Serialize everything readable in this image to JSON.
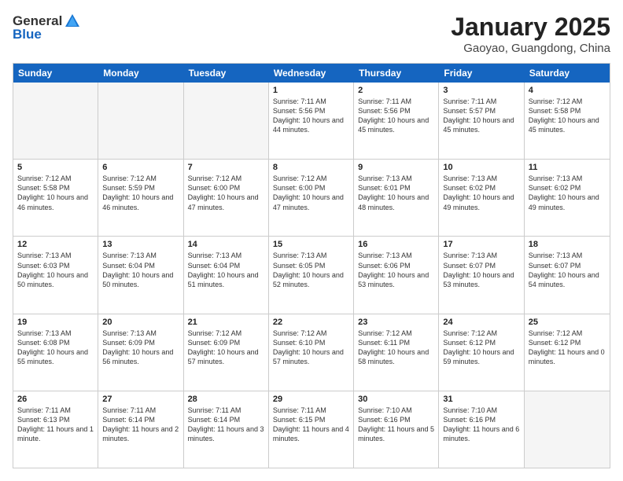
{
  "logo": {
    "general": "General",
    "blue": "Blue"
  },
  "title": "January 2025",
  "location": "Gaoyao, Guangdong, China",
  "day_headers": [
    "Sunday",
    "Monday",
    "Tuesday",
    "Wednesday",
    "Thursday",
    "Friday",
    "Saturday"
  ],
  "weeks": [
    [
      {
        "day": "",
        "empty": true
      },
      {
        "day": "",
        "empty": true
      },
      {
        "day": "",
        "empty": true
      },
      {
        "day": "1",
        "sunrise": "Sunrise: 7:11 AM",
        "sunset": "Sunset: 5:56 PM",
        "daylight": "Daylight: 10 hours and 44 minutes."
      },
      {
        "day": "2",
        "sunrise": "Sunrise: 7:11 AM",
        "sunset": "Sunset: 5:56 PM",
        "daylight": "Daylight: 10 hours and 45 minutes."
      },
      {
        "day": "3",
        "sunrise": "Sunrise: 7:11 AM",
        "sunset": "Sunset: 5:57 PM",
        "daylight": "Daylight: 10 hours and 45 minutes."
      },
      {
        "day": "4",
        "sunrise": "Sunrise: 7:12 AM",
        "sunset": "Sunset: 5:58 PM",
        "daylight": "Daylight: 10 hours and 45 minutes."
      }
    ],
    [
      {
        "day": "5",
        "sunrise": "Sunrise: 7:12 AM",
        "sunset": "Sunset: 5:58 PM",
        "daylight": "Daylight: 10 hours and 46 minutes."
      },
      {
        "day": "6",
        "sunrise": "Sunrise: 7:12 AM",
        "sunset": "Sunset: 5:59 PM",
        "daylight": "Daylight: 10 hours and 46 minutes."
      },
      {
        "day": "7",
        "sunrise": "Sunrise: 7:12 AM",
        "sunset": "Sunset: 6:00 PM",
        "daylight": "Daylight: 10 hours and 47 minutes."
      },
      {
        "day": "8",
        "sunrise": "Sunrise: 7:12 AM",
        "sunset": "Sunset: 6:00 PM",
        "daylight": "Daylight: 10 hours and 47 minutes."
      },
      {
        "day": "9",
        "sunrise": "Sunrise: 7:13 AM",
        "sunset": "Sunset: 6:01 PM",
        "daylight": "Daylight: 10 hours and 48 minutes."
      },
      {
        "day": "10",
        "sunrise": "Sunrise: 7:13 AM",
        "sunset": "Sunset: 6:02 PM",
        "daylight": "Daylight: 10 hours and 49 minutes."
      },
      {
        "day": "11",
        "sunrise": "Sunrise: 7:13 AM",
        "sunset": "Sunset: 6:02 PM",
        "daylight": "Daylight: 10 hours and 49 minutes."
      }
    ],
    [
      {
        "day": "12",
        "sunrise": "Sunrise: 7:13 AM",
        "sunset": "Sunset: 6:03 PM",
        "daylight": "Daylight: 10 hours and 50 minutes."
      },
      {
        "day": "13",
        "sunrise": "Sunrise: 7:13 AM",
        "sunset": "Sunset: 6:04 PM",
        "daylight": "Daylight: 10 hours and 50 minutes."
      },
      {
        "day": "14",
        "sunrise": "Sunrise: 7:13 AM",
        "sunset": "Sunset: 6:04 PM",
        "daylight": "Daylight: 10 hours and 51 minutes."
      },
      {
        "day": "15",
        "sunrise": "Sunrise: 7:13 AM",
        "sunset": "Sunset: 6:05 PM",
        "daylight": "Daylight: 10 hours and 52 minutes."
      },
      {
        "day": "16",
        "sunrise": "Sunrise: 7:13 AM",
        "sunset": "Sunset: 6:06 PM",
        "daylight": "Daylight: 10 hours and 53 minutes."
      },
      {
        "day": "17",
        "sunrise": "Sunrise: 7:13 AM",
        "sunset": "Sunset: 6:07 PM",
        "daylight": "Daylight: 10 hours and 53 minutes."
      },
      {
        "day": "18",
        "sunrise": "Sunrise: 7:13 AM",
        "sunset": "Sunset: 6:07 PM",
        "daylight": "Daylight: 10 hours and 54 minutes."
      }
    ],
    [
      {
        "day": "19",
        "sunrise": "Sunrise: 7:13 AM",
        "sunset": "Sunset: 6:08 PM",
        "daylight": "Daylight: 10 hours and 55 minutes."
      },
      {
        "day": "20",
        "sunrise": "Sunrise: 7:13 AM",
        "sunset": "Sunset: 6:09 PM",
        "daylight": "Daylight: 10 hours and 56 minutes."
      },
      {
        "day": "21",
        "sunrise": "Sunrise: 7:12 AM",
        "sunset": "Sunset: 6:09 PM",
        "daylight": "Daylight: 10 hours and 57 minutes."
      },
      {
        "day": "22",
        "sunrise": "Sunrise: 7:12 AM",
        "sunset": "Sunset: 6:10 PM",
        "daylight": "Daylight: 10 hours and 57 minutes."
      },
      {
        "day": "23",
        "sunrise": "Sunrise: 7:12 AM",
        "sunset": "Sunset: 6:11 PM",
        "daylight": "Daylight: 10 hours and 58 minutes."
      },
      {
        "day": "24",
        "sunrise": "Sunrise: 7:12 AM",
        "sunset": "Sunset: 6:12 PM",
        "daylight": "Daylight: 10 hours and 59 minutes."
      },
      {
        "day": "25",
        "sunrise": "Sunrise: 7:12 AM",
        "sunset": "Sunset: 6:12 PM",
        "daylight": "Daylight: 11 hours and 0 minutes."
      }
    ],
    [
      {
        "day": "26",
        "sunrise": "Sunrise: 7:11 AM",
        "sunset": "Sunset: 6:13 PM",
        "daylight": "Daylight: 11 hours and 1 minute."
      },
      {
        "day": "27",
        "sunrise": "Sunrise: 7:11 AM",
        "sunset": "Sunset: 6:14 PM",
        "daylight": "Daylight: 11 hours and 2 minutes."
      },
      {
        "day": "28",
        "sunrise": "Sunrise: 7:11 AM",
        "sunset": "Sunset: 6:14 PM",
        "daylight": "Daylight: 11 hours and 3 minutes."
      },
      {
        "day": "29",
        "sunrise": "Sunrise: 7:11 AM",
        "sunset": "Sunset: 6:15 PM",
        "daylight": "Daylight: 11 hours and 4 minutes."
      },
      {
        "day": "30",
        "sunrise": "Sunrise: 7:10 AM",
        "sunset": "Sunset: 6:16 PM",
        "daylight": "Daylight: 11 hours and 5 minutes."
      },
      {
        "day": "31",
        "sunrise": "Sunrise: 7:10 AM",
        "sunset": "Sunset: 6:16 PM",
        "daylight": "Daylight: 11 hours and 6 minutes."
      },
      {
        "day": "",
        "empty": true
      }
    ]
  ]
}
